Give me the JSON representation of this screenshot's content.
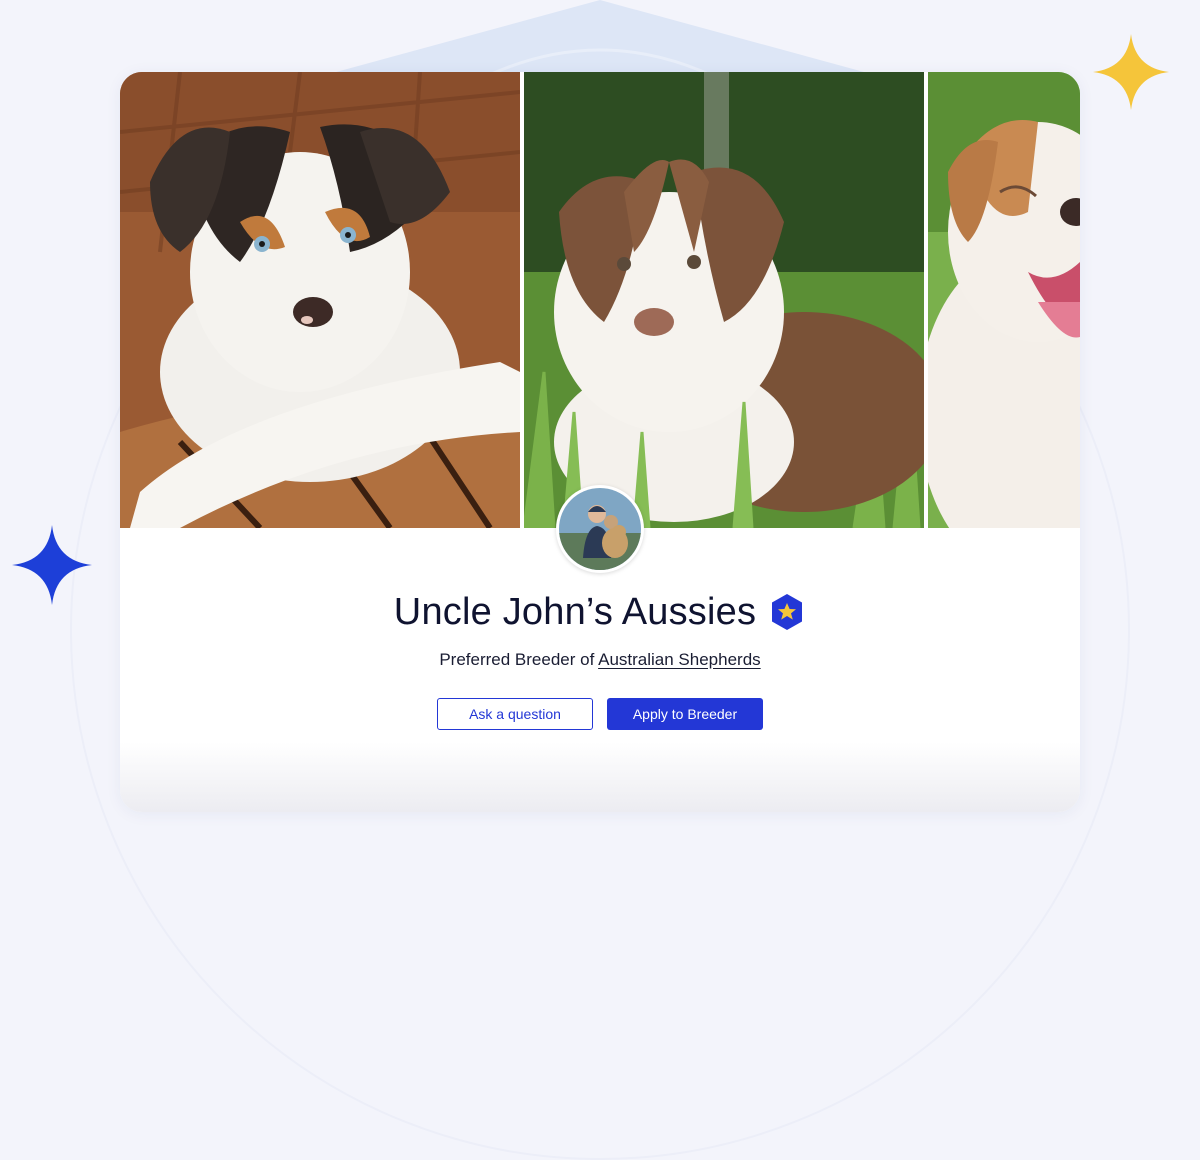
{
  "breeder": {
    "name": "Uncle John’s Aussies",
    "subtitle_prefix": "Preferred Breeder of ",
    "breed": "Australian Shepherds"
  },
  "actions": {
    "ask_label": "Ask a question",
    "apply_label": "Apply to Breeder"
  },
  "icons": {
    "badge": "preferred-breeder-star-icon",
    "sparkle_yellow": "sparkle-icon",
    "sparkle_blue": "sparkle-icon"
  },
  "colors": {
    "accent": "#2337d6",
    "badge": "#2337d6",
    "badge_star": "#f5c53a",
    "sparkle_yellow": "#f5c53a",
    "sparkle_blue": "#1d3fd8",
    "background": "#f3f4fb"
  }
}
